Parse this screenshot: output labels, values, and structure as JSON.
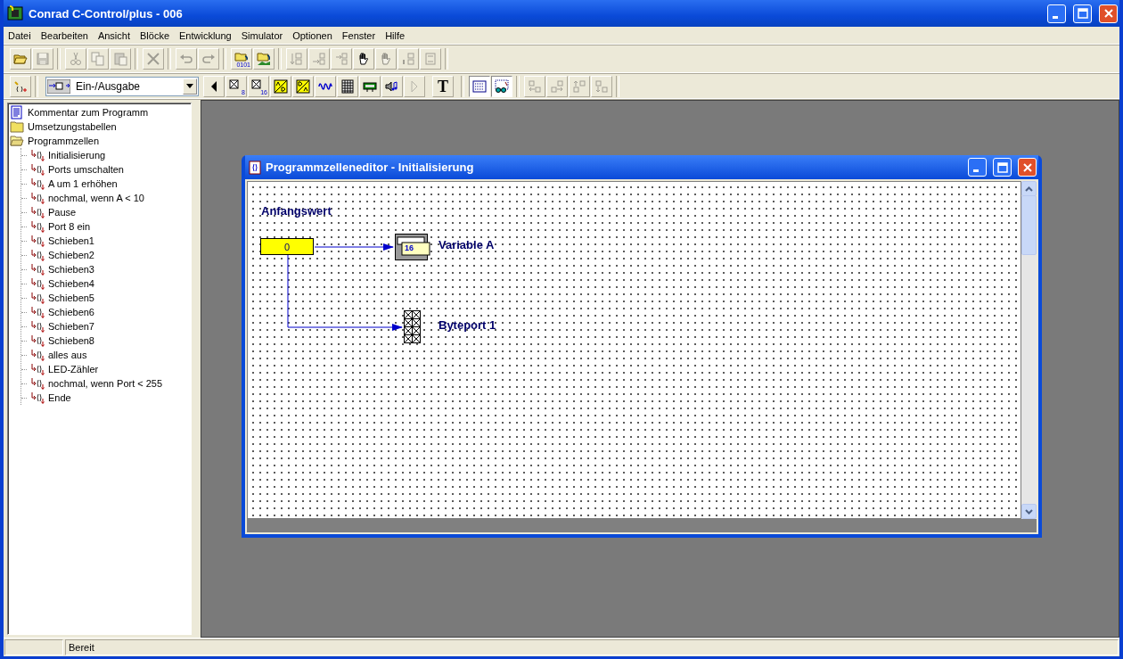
{
  "window": {
    "title": "Conrad C-Control/plus - 006"
  },
  "menu": [
    "Datei",
    "Bearbeiten",
    "Ansicht",
    "Blöcke",
    "Entwicklung",
    "Simulator",
    "Optionen",
    "Fenster",
    "Hilfe"
  ],
  "toolbar_1": [
    {
      "buttons": [
        {
          "kind": "open",
          "disabled": false
        },
        {
          "kind": "save",
          "disabled": true
        }
      ]
    },
    {
      "buttons": [
        {
          "kind": "cut",
          "disabled": true
        },
        {
          "kind": "copy",
          "disabled": true
        },
        {
          "kind": "paste",
          "disabled": true
        }
      ]
    },
    {
      "buttons": [
        {
          "kind": "delete",
          "disabled": true
        }
      ]
    },
    {
      "buttons": [
        {
          "kind": "undo",
          "disabled": true
        },
        {
          "kind": "redo",
          "disabled": true
        }
      ]
    },
    {
      "buttons": [
        {
          "kind": "compile",
          "disabled": false,
          "sub": "0101"
        },
        {
          "kind": "download",
          "disabled": false
        }
      ]
    },
    {
      "buttons": [
        {
          "kind": "block_down",
          "disabled": true
        },
        {
          "kind": "block_right",
          "disabled": true
        },
        {
          "kind": "block_in",
          "disabled": true
        },
        {
          "kind": "hand",
          "disabled": false
        },
        {
          "kind": "hand",
          "disabled": true
        },
        {
          "kind": "block_left",
          "disabled": true
        },
        {
          "kind": "block_swap",
          "disabled": true
        }
      ]
    }
  ],
  "toolbar_2": {
    "tool": {
      "kind": "wand",
      "disabled": false
    },
    "dropdown": {
      "value": "Ein-/Ausgabe"
    },
    "palette": [
      {
        "kind": "prev",
        "disabled": false
      },
      {
        "kind": "port",
        "sub": "8",
        "disabled": false
      },
      {
        "kind": "port",
        "sub": "16",
        "disabled": false
      },
      {
        "kind": "ad",
        "disabled": false
      },
      {
        "kind": "da",
        "disabled": false
      },
      {
        "kind": "wave",
        "disabled": false
      },
      {
        "kind": "keypad",
        "disabled": false
      },
      {
        "kind": "display",
        "disabled": false
      },
      {
        "kind": "speaker",
        "disabled": false
      },
      {
        "kind": "next",
        "disabled": true
      }
    ],
    "text_tool": {
      "label": "T"
    },
    "view": [
      {
        "kind": "dotgrid",
        "selected": true
      },
      {
        "kind": "glasses",
        "selected": true
      }
    ],
    "layout": [
      {
        "kind": "align_left",
        "disabled": true
      },
      {
        "kind": "align_right",
        "disabled": true
      },
      {
        "kind": "align_up",
        "disabled": true
      },
      {
        "kind": "align_down",
        "disabled": true
      }
    ]
  },
  "tree": [
    {
      "label": "Kommentar zum Programm",
      "kind": "comment"
    },
    {
      "label": "Umsetzungstabellen",
      "kind": "folder",
      "expanded": false
    },
    {
      "label": "Programmzellen",
      "kind": "folder",
      "expanded": true,
      "children": [
        {
          "label": "Initialisierung",
          "kind": "cell"
        },
        {
          "label": "Ports umschalten",
          "kind": "cell"
        },
        {
          "label": "A um 1 erhöhen",
          "kind": "cell"
        },
        {
          "label": "nochmal, wenn A < 10",
          "kind": "cell"
        },
        {
          "label": "Pause",
          "kind": "cell"
        },
        {
          "label": "Port 8 ein",
          "kind": "cell"
        },
        {
          "label": "Schieben1",
          "kind": "cell"
        },
        {
          "label": "Schieben2",
          "kind": "cell"
        },
        {
          "label": "Schieben3",
          "kind": "cell"
        },
        {
          "label": "Schieben4",
          "kind": "cell"
        },
        {
          "label": "Schieben5",
          "kind": "cell"
        },
        {
          "label": "Schieben6",
          "kind": "cell"
        },
        {
          "label": "Schieben7",
          "kind": "cell"
        },
        {
          "label": "Schieben8",
          "kind": "cell"
        },
        {
          "label": "alles aus",
          "kind": "cell"
        },
        {
          "label": "LED-Zähler",
          "kind": "cell"
        },
        {
          "label": "nochmal, wenn Port < 255",
          "kind": "cell"
        },
        {
          "label": "Ende",
          "kind": "cell"
        }
      ]
    }
  ],
  "editor": {
    "title": "Programmzelleneditor - Initialisierung",
    "labels": [
      "Anfangswert"
    ],
    "blocks": [
      {
        "kind": "constant",
        "value": "0"
      },
      {
        "kind": "variable",
        "badge": "16",
        "label": "Variable A"
      },
      {
        "kind": "byteport",
        "label": "Byteport 1"
      }
    ]
  },
  "status_bar": {
    "text": "Bereit"
  }
}
